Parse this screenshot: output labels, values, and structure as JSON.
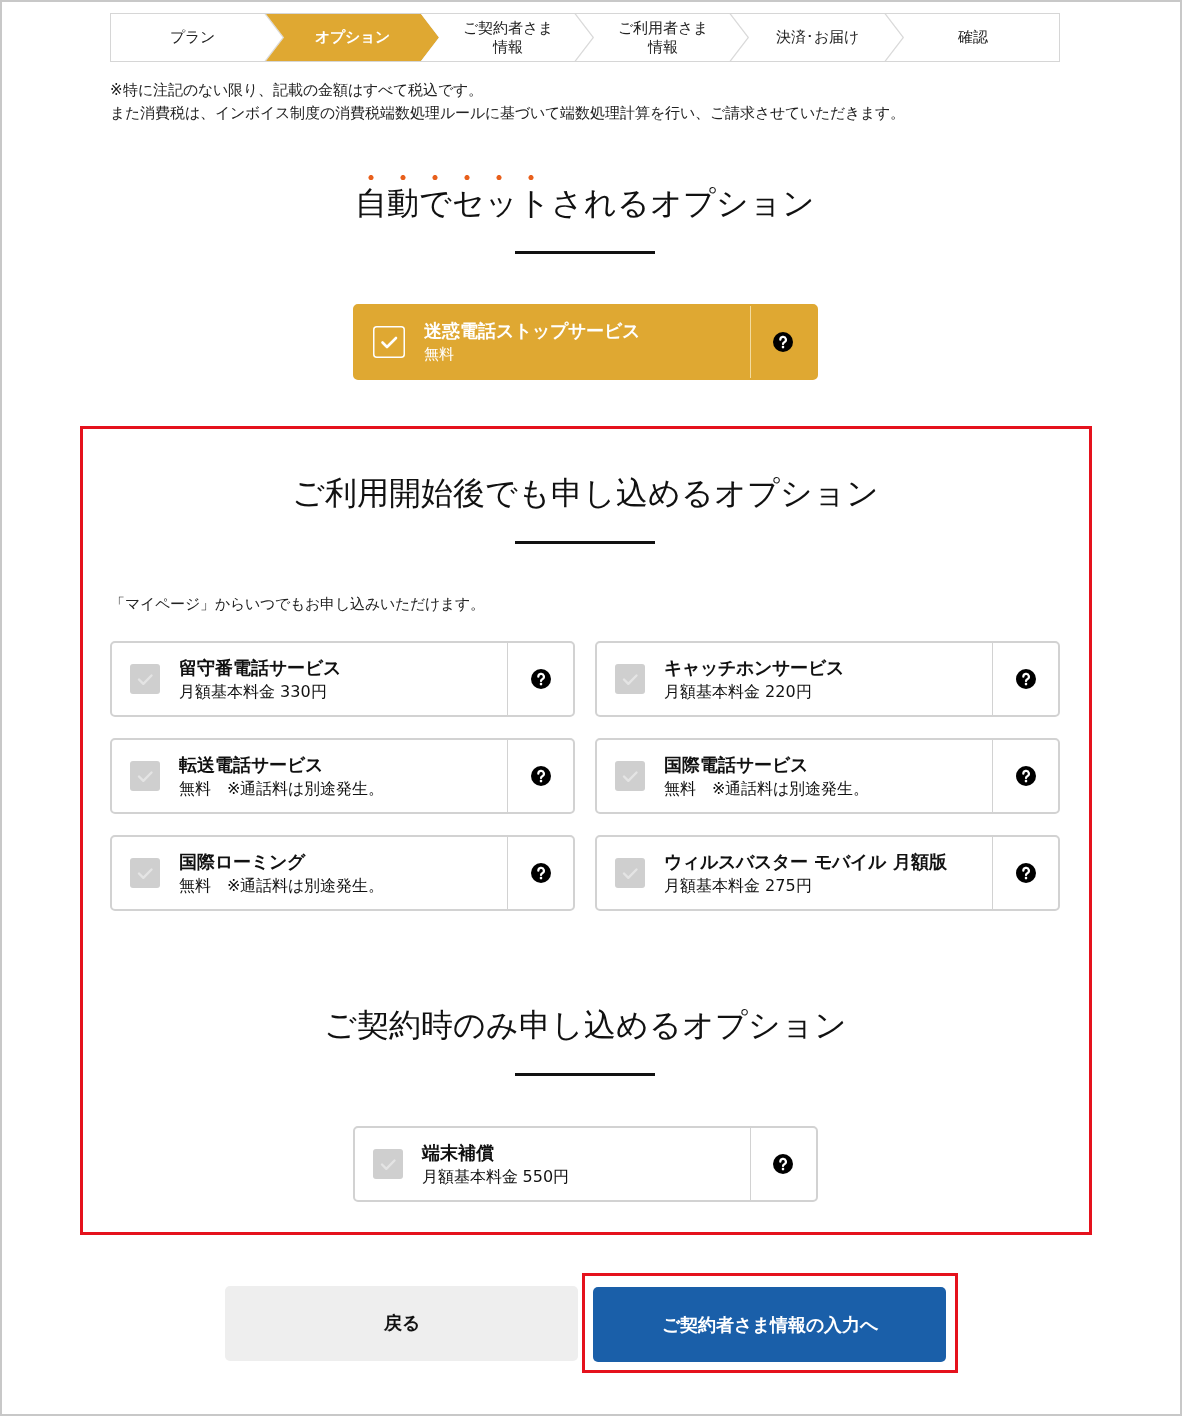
{
  "steps": [
    {
      "label": "プラン",
      "selected": false
    },
    {
      "label": "オプション",
      "selected": true
    },
    {
      "label": "ご契約者さま情報",
      "selected": false
    },
    {
      "label": "ご利用者さま情報",
      "selected": false
    },
    {
      "label": "決済･お届け",
      "selected": false
    },
    {
      "label": "確認",
      "selected": false
    }
  ],
  "notes": [
    "※特に注記のない限り、記載の金額はすべて税込です。",
    "また消費税は、インボイス制度の消費税端数処理ルールに基づいて端数処理計算を行い、ご請求させていただきます。"
  ],
  "sections": [
    {
      "highlighted": false,
      "title_parts": [
        {
          "text": "自動でセット",
          "emphasized": true
        },
        {
          "text": "されるオプション",
          "emphasized": false
        }
      ],
      "options": [
        {
          "name": "迷惑電話ストップサービス",
          "price": "無料",
          "checked": true
        }
      ]
    },
    {
      "highlighted": true,
      "title_parts": [
        {
          "text": "ご利用開始後でも申し込めるオプション",
          "emphasized": false
        }
      ],
      "note": "「マイページ」からいつでもお申し込みいただけます。",
      "options": [
        {
          "name": "留守番電話サービス",
          "price": "月額基本料金 330円",
          "checked": false
        },
        {
          "name": "キャッチホンサービス",
          "price": "月額基本料金 220円",
          "checked": false
        },
        {
          "name": "転送電話サービス",
          "price": "無料　※通話料は別途発生。",
          "checked": false
        },
        {
          "name": "国際電話サービス",
          "price": "無料　※通話料は別途発生。",
          "checked": false
        },
        {
          "name": "国際ローミング",
          "price": "無料　※通話料は別途発生。",
          "checked": false
        },
        {
          "name": "ウィルスバスター モバイル 月額版",
          "price": "月額基本料金 275円",
          "checked": false
        }
      ]
    },
    {
      "highlighted": true,
      "title_parts": [
        {
          "text": "ご契約時のみ申し込めるオプション",
          "emphasized": false
        }
      ],
      "options": [
        {
          "name": "端末補償",
          "price": "月額基本料金 550円",
          "checked": false
        }
      ]
    }
  ],
  "buttons": [
    {
      "kind": "back",
      "label": "戻る",
      "highlighted": false
    },
    {
      "kind": "next",
      "label": "ご契約者さま情報の入力へ",
      "highlighted": true
    }
  ]
}
